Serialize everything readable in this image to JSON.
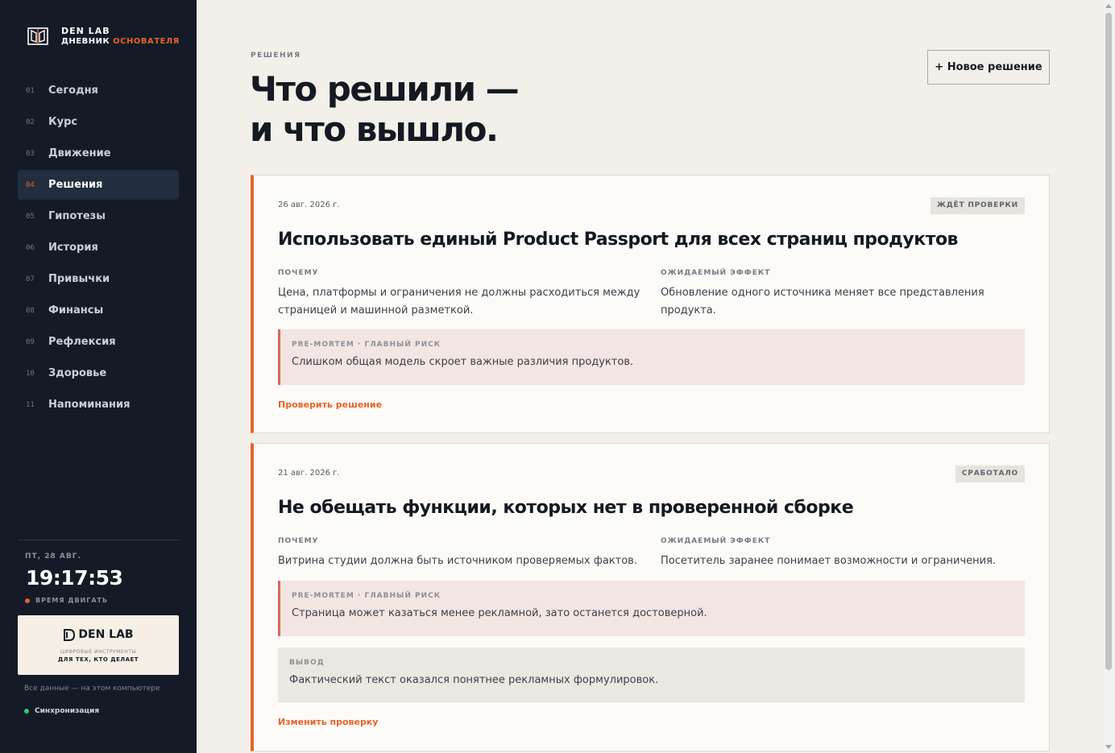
{
  "brand": {
    "name": "DEN LAB",
    "sub_prefix": "ДНЕВНИК ",
    "sub_accent": "ОСНОВАТЕЛЯ"
  },
  "nav": [
    {
      "num": "01",
      "label": "Сегодня"
    },
    {
      "num": "02",
      "label": "Курс"
    },
    {
      "num": "03",
      "label": "Движение"
    },
    {
      "num": "04",
      "label": "Решения",
      "active": true
    },
    {
      "num": "05",
      "label": "Гипотезы"
    },
    {
      "num": "06",
      "label": "История"
    },
    {
      "num": "07",
      "label": "Привычки"
    },
    {
      "num": "08",
      "label": "Финансы"
    },
    {
      "num": "09",
      "label": "Рефлексия"
    },
    {
      "num": "10",
      "label": "Здоровье"
    },
    {
      "num": "11",
      "label": "Напоминания"
    }
  ],
  "sidebar_footer": {
    "date": "ПТ, 28 АВГ.",
    "time": "19:17:53",
    "motto": "ВРЕМЯ ДВИГАТЬ",
    "promo_title": "DEN LAB",
    "promo_sub1": "ЦИФРОВЫЕ ИНСТРУМЕНТЫ",
    "promo_sub2": "ДЛЯ ТЕХ, КТО ДЕЛАЕТ",
    "local_note": "Все данные — на этом компьютере",
    "sync": "Синхронизация"
  },
  "header": {
    "eyebrow": "РЕШЕНИЯ",
    "title_line1": "Что решили —",
    "title_line2": "и что вышло.",
    "new_button": "+ Новое решение"
  },
  "decisions": [
    {
      "date": "26 авг. 2026 г.",
      "status": "ЖДЁТ ПРОВЕРКИ",
      "title": "Использовать единый Product Passport для всех страниц продуктов",
      "why_label": "ПОЧЕМУ",
      "why": "Цена, платформы и ограничения не должны расходиться между страницей и машинной разметкой.",
      "effect_label": "ОЖИДАЕМЫЙ ЭФФЕКТ",
      "effect": "Обновление одного источника меняет все представления продукта.",
      "risk_label": "PRE-MORTEM · ГЛАВНЫЙ РИСК",
      "risk": "Слишком общая модель скроет важные различия продуктов.",
      "link": "Проверить решение"
    },
    {
      "date": "21 авг. 2026 г.",
      "status": "СРАБОТАЛО",
      "title": "Не обещать функции, которых нет в проверенной сборке",
      "why_label": "ПОЧЕМУ",
      "why": "Витрина студии должна быть источником проверяемых фактов.",
      "effect_label": "ОЖИДАЕМЫЙ ЭФФЕКТ",
      "effect": "Посетитель заранее понимает возможности и ограничения.",
      "risk_label": "PRE-MORTEM · ГЛАВНЫЙ РИСК",
      "risk": "Страница может казаться менее рекламной, зато останется достоверной.",
      "conclusion_label": "ВЫВОД",
      "conclusion": "Фактический текст оказался понятнее рекламных формулировок.",
      "link": "Изменить проверку"
    }
  ],
  "colors": {
    "accent": "#e8622a",
    "sidebar_bg": "#141b26",
    "page_bg": "#f3f0ea",
    "sync_dot": "#2ecc71"
  }
}
